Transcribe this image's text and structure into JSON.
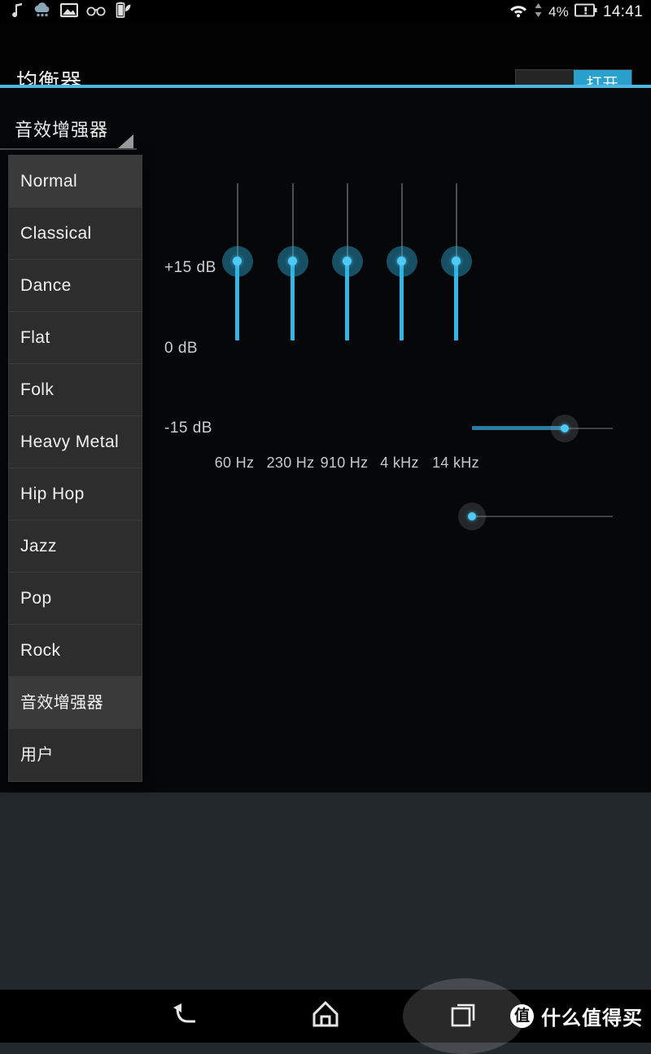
{
  "status_bar": {
    "left_icons": [
      "music-note-icon",
      "rain-cloud-icon",
      "image-icon",
      "glasses-icon",
      "battery-leaf-icon"
    ],
    "wifi_icon": "wifi-icon",
    "data_arrows_icon": "data-transfer-arrows-icon",
    "battery_percent": "4%",
    "battery_icon": "battery-alert-icon",
    "clock": "14:41"
  },
  "action_bar": {
    "title": "均衡器",
    "toggle_on_label": "打开",
    "toggle_state": "on",
    "accent_color": "#4cb4dd",
    "toggle_on_color": "#2aa0cc"
  },
  "spinner": {
    "selected": "音效增强器",
    "caret_icon": "dropdown-caret-icon"
  },
  "dropdown": {
    "open": true,
    "selected_index": 10,
    "items": [
      {
        "label": "Normal"
      },
      {
        "label": "Classical"
      },
      {
        "label": "Dance"
      },
      {
        "label": "Flat"
      },
      {
        "label": "Folk"
      },
      {
        "label": "Heavy Metal"
      },
      {
        "label": "Hip Hop"
      },
      {
        "label": "Jazz"
      },
      {
        "label": "Pop"
      },
      {
        "label": "Rock"
      },
      {
        "label": "音效增强器"
      },
      {
        "label": "用户"
      }
    ]
  },
  "equalizer": {
    "db_labels": {
      "max": "+15 dB",
      "mid": "0 dB",
      "min": "-15 dB"
    },
    "bands": [
      {
        "freq_label": "60 Hz",
        "value_db": 0
      },
      {
        "freq_label": "230 Hz",
        "value_db": 0
      },
      {
        "freq_label": "910 Hz",
        "value_db": 0
      },
      {
        "freq_label": "4 kHz",
        "value_db": 0
      },
      {
        "freq_label": "14 kHz",
        "value_db": 0
      }
    ],
    "fill_color": "#33b5e5",
    "thumb_color": "#4fc9f5"
  },
  "effect_sliders": [
    {
      "name": "bass-boost-slider",
      "percent": 66
    },
    {
      "name": "virtualizer-slider",
      "percent": 0
    }
  ],
  "chart_data": {
    "type": "bar",
    "title": "均衡器",
    "xlabel": "",
    "ylabel": "dB",
    "categories": [
      "60 Hz",
      "230 Hz",
      "910 Hz",
      "4 kHz",
      "14 kHz"
    ],
    "values": [
      0,
      0,
      0,
      0,
      0
    ],
    "ylim": [
      -15,
      15
    ],
    "ytick_labels": [
      "+15 dB",
      "0 dB",
      "-15 dB"
    ],
    "grid": false,
    "legend": "none"
  },
  "nav_bar": {
    "back_icon": "back-arrow-icon",
    "home_icon": "home-icon",
    "recents_icon": "recents-icon",
    "recents_pressed": true
  },
  "watermark": {
    "badge": "值",
    "text": "什么值得买"
  }
}
